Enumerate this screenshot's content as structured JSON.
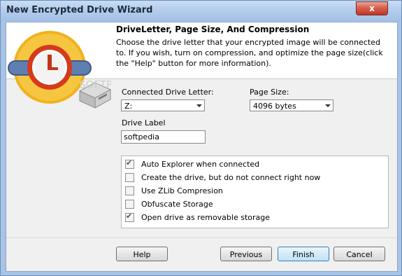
{
  "window": {
    "title": "New Encrypted Drive Wizard",
    "close_glyph": "x"
  },
  "header": {
    "title": "DriveLetter, Page Size, And Compression",
    "description": "Choose the drive letter that your encrypted image will be connected to. If you wish, turn on compression, and optimize the page size(click the \"Help\" button for more information).",
    "logo_icon": "encrypted-drive-logo-icon",
    "watermark": "SOFTPEDIA"
  },
  "form": {
    "drive_letter_label": "Connected Drive Letter:",
    "drive_letter_value": "Z:",
    "page_size_label": "Page Size:",
    "page_size_value": "4096 bytes",
    "drive_label_label": "Drive Label",
    "drive_label_value": "softpedia"
  },
  "options": [
    {
      "label": "Auto Explorer when connected",
      "checked": true
    },
    {
      "label": "Create the drive, but do not connect right now",
      "checked": false
    },
    {
      "label": "Use ZLib Compresion",
      "checked": false
    },
    {
      "label": "Obfuscate Storage",
      "checked": false
    },
    {
      "label": "Open drive as removable storage",
      "checked": true
    }
  ],
  "buttons": {
    "help": "Help",
    "previous": "Previous",
    "finish": "Finish",
    "cancel": "Cancel"
  },
  "colors": {
    "accent": "#f0b21e",
    "titlebar": "#b4cdec",
    "close": "#c0362a"
  }
}
